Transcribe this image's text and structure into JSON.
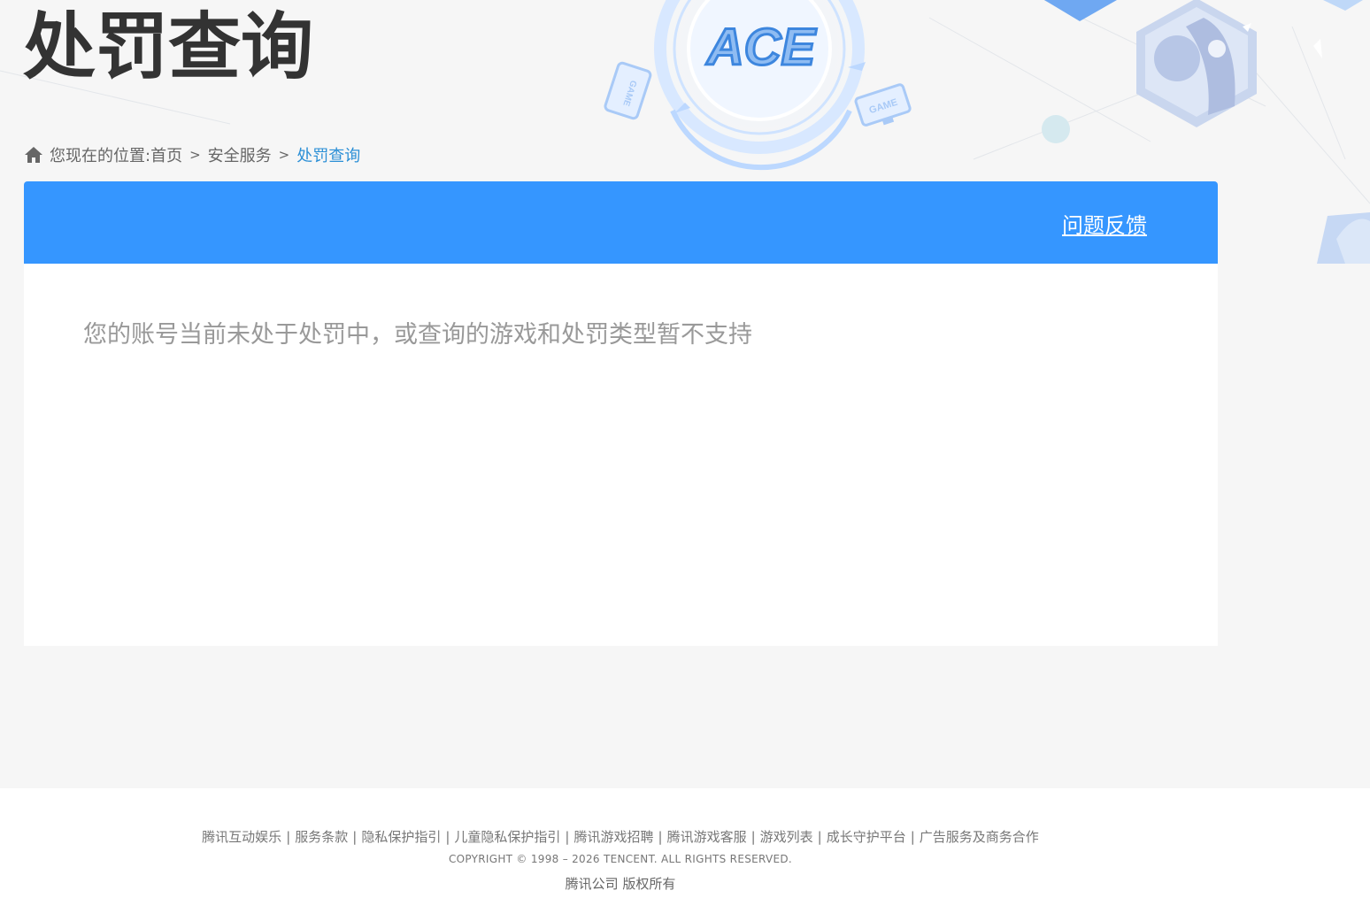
{
  "header": {
    "title": "处罚查询",
    "logo_text": "ACE",
    "badge_text": "GAME"
  },
  "breadcrumb": {
    "prefix": "您现在的位置:",
    "items": [
      "首页",
      "安全服务",
      "处罚查询"
    ],
    "separator": ">"
  },
  "panel": {
    "feedback_label": "问题反馈",
    "message": "您的账号当前未处于处罚中，或查询的游戏和处罚类型暂不支持",
    "header_color": "#3596ff"
  },
  "footer": {
    "links": [
      "腾讯互动娱乐",
      "服务条款",
      "隐私保护指引",
      "儿童隐私保护指引",
      "腾讯游戏招聘",
      "腾讯游戏客服",
      "游戏列表",
      "成长守护平台",
      "广告服务及商务合作"
    ],
    "copyright": "COPYRIGHT © 1998 – 2026 TENCENT. ALL RIGHTS RESERVED.",
    "company": "腾讯公司 版权所有"
  }
}
